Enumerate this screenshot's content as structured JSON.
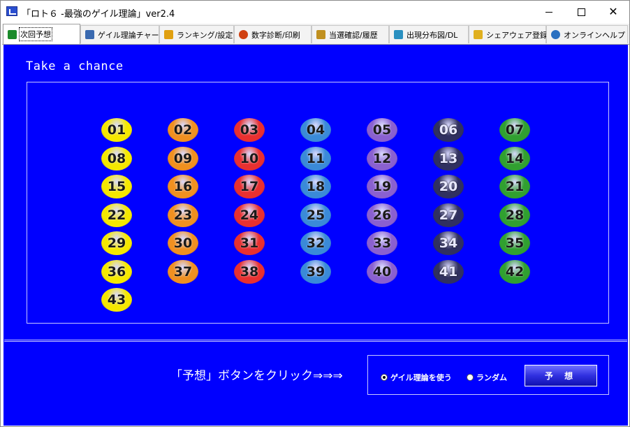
{
  "window": {
    "title": "「ロト６ -最強のゲイル理論」ver2.4",
    "minimize_label": "",
    "maximize_label": "",
    "close_label": "✕"
  },
  "tabs": [
    {
      "label": "次回予想",
      "icon": "next-prediction-icon",
      "color": "#1a8a2a",
      "active": true
    },
    {
      "label": "ゲイル理論チャート",
      "icon": "chart-icon",
      "color": "#3a6ab0",
      "active": false
    },
    {
      "label": "ランキング/設定",
      "icon": "ranking-icon",
      "color": "#e0a010",
      "active": false
    },
    {
      "label": "数字診断/印刷",
      "icon": "diagnosis-icon",
      "color": "#d04010",
      "active": false
    },
    {
      "label": "当選確認/履歴",
      "icon": "history-icon",
      "color": "#c09020",
      "active": false
    },
    {
      "label": "出現分布図/DL",
      "icon": "distribution-icon",
      "color": "#2a90c0",
      "active": false
    },
    {
      "label": "シェアウェア登録",
      "icon": "lock-icon",
      "color": "#e0b020",
      "active": false
    },
    {
      "label": "オンラインヘルプ",
      "icon": "help-icon",
      "color": "#2a70c0",
      "active": false
    }
  ],
  "main": {
    "heading": "Take a chance",
    "balls": [
      "01",
      "02",
      "03",
      "04",
      "05",
      "06",
      "07",
      "08",
      "09",
      "10",
      "11",
      "12",
      "13",
      "14",
      "15",
      "16",
      "17",
      "18",
      "19",
      "20",
      "21",
      "22",
      "23",
      "24",
      "25",
      "26",
      "27",
      "28",
      "29",
      "30",
      "31",
      "32",
      "33",
      "34",
      "35",
      "36",
      "37",
      "38",
      "39",
      "40",
      "41",
      "42",
      "43"
    ],
    "column_colors": [
      "#f5e800",
      "#f09020",
      "#e83030",
      "#3a8ad8",
      "#8a60d0",
      "#303060",
      "#30a030"
    ]
  },
  "footer": {
    "prompt": "「予想」ボタンをクリック⇒⇒⇒",
    "option_gail": "ゲイル理論を使う",
    "option_random": "ランダム",
    "selected": "gail",
    "predict_button": "予 想"
  }
}
